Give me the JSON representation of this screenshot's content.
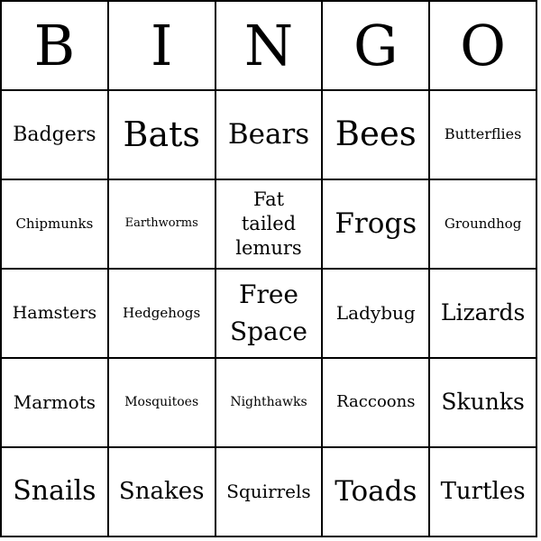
{
  "header": [
    "B",
    "I",
    "N",
    "G",
    "O"
  ],
  "rows": [
    [
      "Badgers",
      "Bats",
      "Bears",
      "Bees",
      "Butterflies"
    ],
    [
      "Chipmunks",
      "Earthworms",
      "Fat tailed lemurs",
      "Frogs",
      "Groundhog"
    ],
    [
      "Hamsters",
      "Hedgehogs",
      "Free Space",
      "Ladybug",
      "Lizards"
    ],
    [
      "Marmots",
      "Mosquitoes",
      "Nighthawks",
      "Raccoons",
      "Skunks"
    ],
    [
      "Snails",
      "Snakes",
      "Squirrels",
      "Toads",
      "Turtles"
    ]
  ]
}
